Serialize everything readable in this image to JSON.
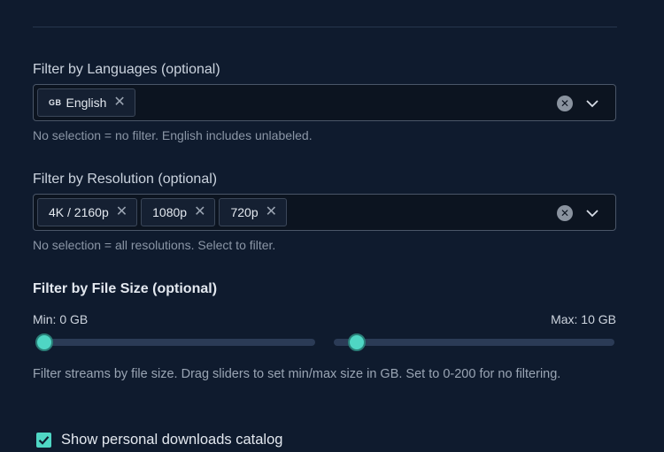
{
  "languages": {
    "label": "Filter by Languages (optional)",
    "chips": [
      {
        "flag": "GB",
        "text": "English"
      }
    ],
    "helper": "No selection = no filter. English includes unlabeled."
  },
  "resolution": {
    "label": "Filter by Resolution (optional)",
    "chips": [
      "4K / 2160p",
      "1080p",
      "720p"
    ],
    "helper": "No selection = all resolutions. Select to filter."
  },
  "file_size": {
    "label": "Filter by File Size (optional)",
    "min_label": "Min: 0 GB",
    "max_label": "Max: 10 GB",
    "min_value_gb": 0,
    "max_value_gb": 10,
    "helper": "Filter streams by file size. Drag sliders to set min/max size in GB. Set to 0-200 for no filtering."
  },
  "personal_catalog": {
    "label": "Show personal downloads catalog",
    "checked": true
  },
  "colors": {
    "accent": "#4fd6c4",
    "background": "#0f1b2e"
  }
}
